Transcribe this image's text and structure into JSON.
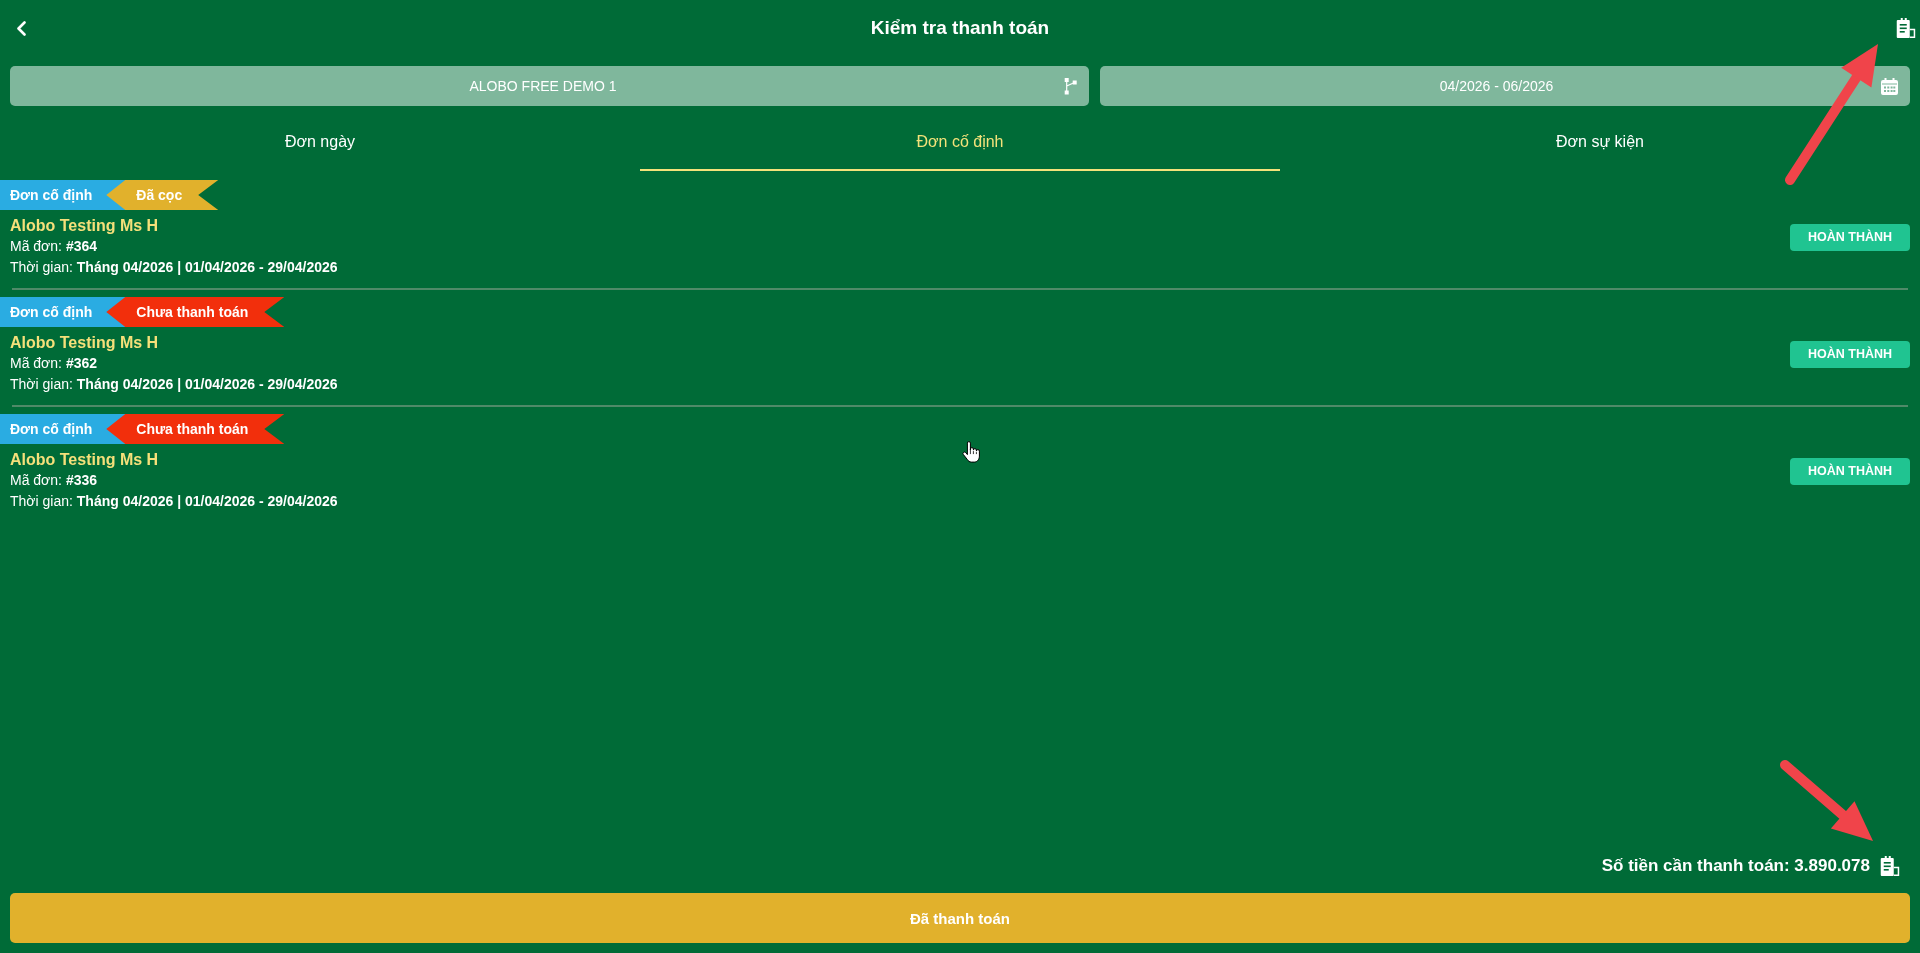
{
  "header": {
    "title": "Kiểm tra thanh toán"
  },
  "filters": [
    {
      "kind": "venue",
      "value": "ALOBO FREE DEMO 1"
    },
    {
      "kind": "date_range",
      "value": "04/2026 - 06/2026"
    }
  ],
  "tabs": [
    {
      "label": "Đơn ngày",
      "selected": false
    },
    {
      "label": "Đơn cố định",
      "selected": true
    },
    {
      "label": "Đơn sự kiện",
      "selected": false
    }
  ],
  "orders": [
    {
      "type_label": "Đơn cố định",
      "status": {
        "label": "Đã cọc",
        "color": "#e1b12c"
      },
      "customer": "Alobo Testing Ms H",
      "code": "Mã đơn: **#364**",
      "time": "Thời gian: **Tháng 04/2026 | 01/04/2026 - 29/04/2026**",
      "action": "HOÀN THÀNH"
    },
    {
      "type_label": "Đơn cố định",
      "status": {
        "label": "Chưa thanh toán",
        "color": "#f22f0c"
      },
      "customer": "Alobo Testing Ms H",
      "code": "Mã đơn: **#362**",
      "time": "Thời gian: **Tháng 04/2026 | 01/04/2026 - 29/04/2026**",
      "action": "HOÀN THÀNH"
    },
    {
      "type_label": "Đơn cố định",
      "status": {
        "label": "Chưa thanh toán",
        "color": "#f22f0c"
      },
      "customer": "Alobo Testing Ms H",
      "code": "Mã đơn: **#336**",
      "time": "Thời gian: **Tháng 04/2026 | 01/04/2026 - 29/04/2026**",
      "action": "HOÀN THÀNH"
    }
  ],
  "total": {
    "text": "Số tiền cần thanh toán: 3.890.078"
  },
  "confirm_button": {
    "label": "Đã thanh toán"
  }
}
